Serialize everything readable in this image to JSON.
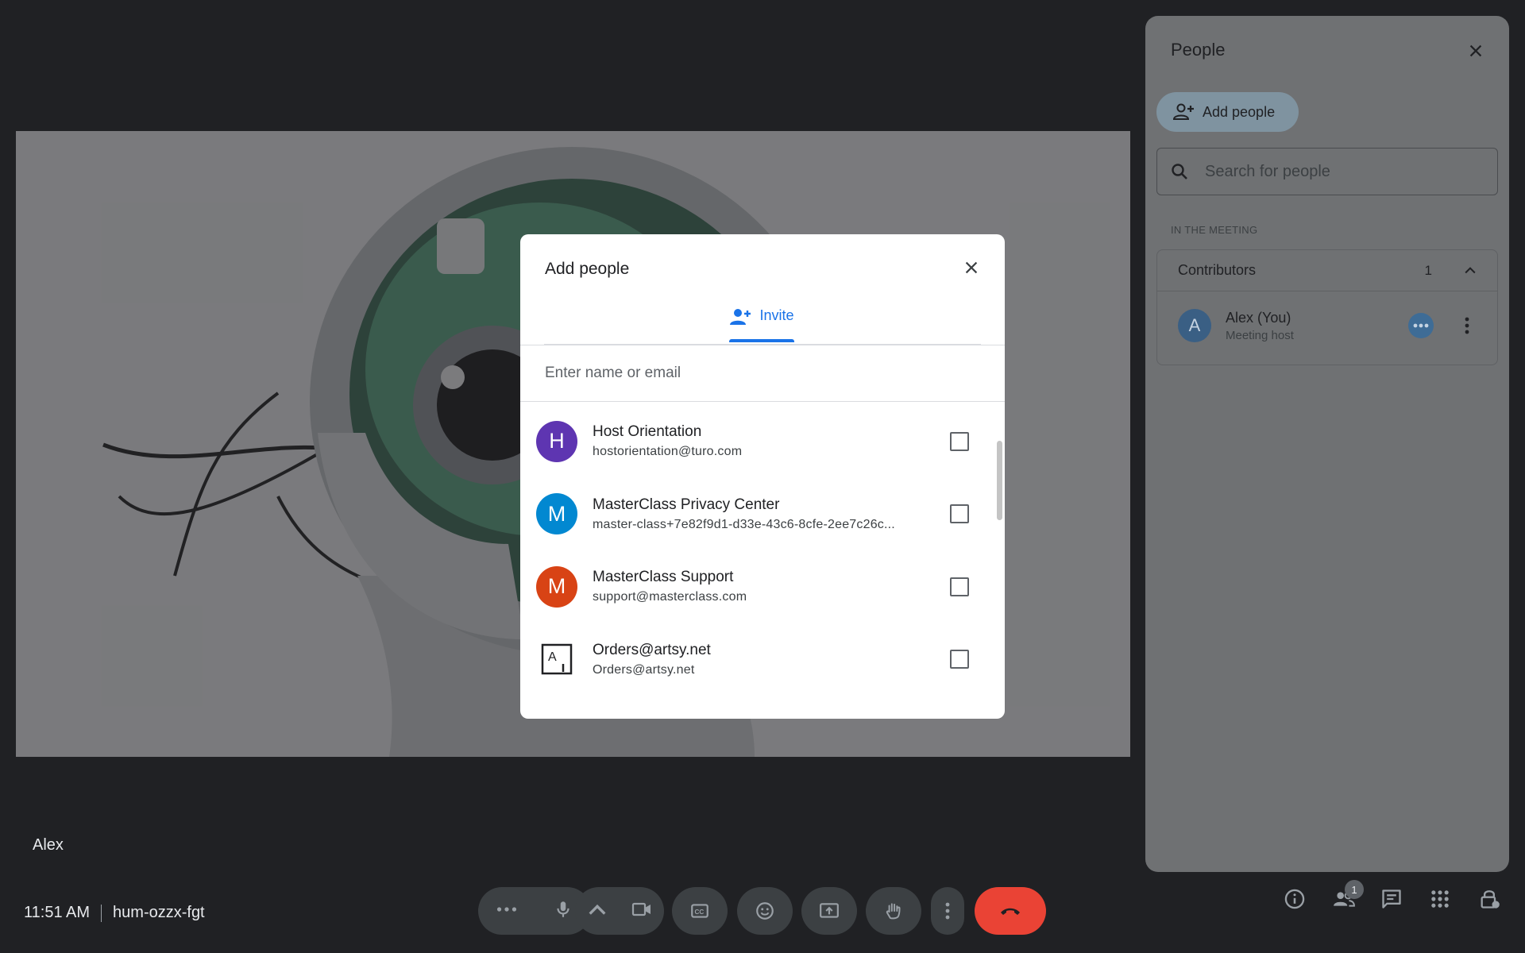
{
  "colors": {
    "accent": "#1a73e8",
    "end_call": "#ea4335"
  },
  "video": {
    "participant_name": "Alex"
  },
  "meeting": {
    "time": "11:51 AM",
    "code": "hum-ozzx-fgt"
  },
  "controls": [
    {
      "name": "more-options-button",
      "icon": "more-horiz-icon"
    },
    {
      "name": "microphone-button",
      "icon": "mic-icon"
    },
    {
      "name": "camera-options-button",
      "icon": "chevron-up-icon"
    },
    {
      "name": "camera-button",
      "icon": "videocam-icon"
    },
    {
      "name": "captions-button",
      "icon": "closed-caption-icon"
    },
    {
      "name": "reactions-button",
      "icon": "emoji-icon"
    },
    {
      "name": "present-button",
      "icon": "present-screen-icon"
    },
    {
      "name": "raise-hand-button",
      "icon": "hand-icon"
    },
    {
      "name": "more-actions-button",
      "icon": "more-vert-icon"
    },
    {
      "name": "leave-call-button",
      "icon": "call-end-icon"
    }
  ],
  "right_icons": [
    "info-icon",
    "people-icon",
    "chat-icon",
    "apps-icon",
    "host-controls-icon"
  ],
  "people_badge": "1",
  "panel": {
    "title": "People",
    "add_people_label": "Add people",
    "search_placeholder": "Search for people",
    "section_label": "IN THE MEETING",
    "group": {
      "label": "Contributors",
      "count": "1"
    },
    "participants": [
      {
        "initial": "A",
        "name": "Alex (You)",
        "role": "Meeting host"
      }
    ]
  },
  "modal": {
    "title": "Add people",
    "tab_label": "Invite",
    "input_placeholder": "Enter name or email",
    "contacts": [
      {
        "initial": "H",
        "color": "#5e35b1",
        "name": "Host Orientation",
        "email": "hostorientation@turo.com"
      },
      {
        "initial": "M",
        "color": "#0288d1",
        "name": "MasterClass Privacy Center",
        "email": "master-class+7e82f9d1-d33e-43c6-8cfe-2ee7c26c..."
      },
      {
        "initial": "M",
        "color": "#d84315",
        "name": "MasterClass Support",
        "email": "support@masterclass.com"
      },
      {
        "initial": "A",
        "color": "#ffffff",
        "name": "Orders@artsy.net",
        "email": "Orders@artsy.net",
        "logo": "artsy-logo-icon"
      }
    ]
  }
}
